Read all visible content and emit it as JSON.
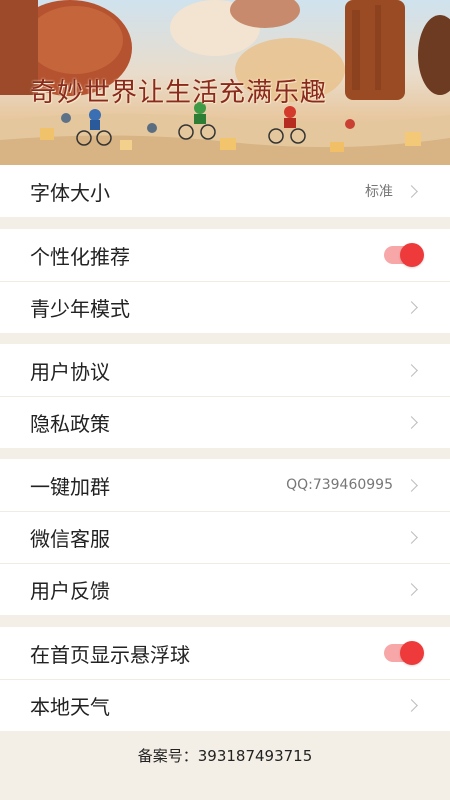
{
  "banner": {
    "title": "奇妙世界让生活充满乐趣"
  },
  "settings": {
    "font_size": {
      "label": "字体大小",
      "value": "标准"
    },
    "personalized": {
      "label": "个性化推荐",
      "toggle": true
    },
    "youth_mode": {
      "label": "青少年模式"
    },
    "user_agreement": {
      "label": "用户协议"
    },
    "privacy_policy": {
      "label": "隐私政策"
    },
    "join_group": {
      "label": "一键加群",
      "value": "QQ:739460995"
    },
    "wechat_service": {
      "label": "微信客服"
    },
    "feedback": {
      "label": "用户反馈"
    },
    "floating_ball": {
      "label": "在首页显示悬浮球",
      "toggle": true
    },
    "local_weather": {
      "label": "本地天气"
    }
  },
  "footer": {
    "record": "备案号：393187493715"
  },
  "colors": {
    "accent": "#ee3a3a",
    "background": "#f4efe6"
  }
}
